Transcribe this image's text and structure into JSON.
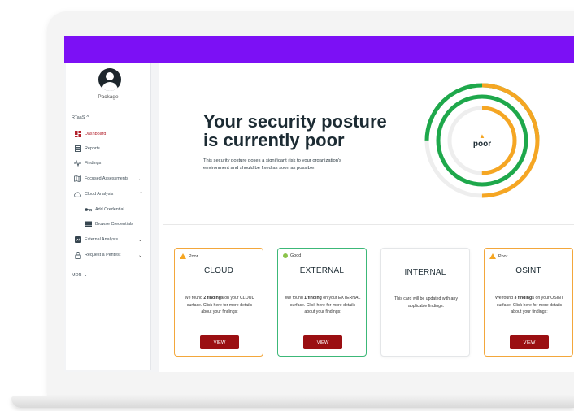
{
  "sidebar": {
    "package_label": "Package",
    "section_rtaas": "RTaaS",
    "section_mdr": "MDR",
    "items": [
      {
        "label": "Dashboard"
      },
      {
        "label": "Reports"
      },
      {
        "label": "Findings"
      },
      {
        "label": "Focused Assessments"
      },
      {
        "label": "Cloud Analysis"
      },
      {
        "label": "Add Credential"
      },
      {
        "label": "Browse Credentials"
      },
      {
        "label": "External Analysis"
      },
      {
        "label": "Request a Pentest"
      }
    ]
  },
  "hero": {
    "title": "Your security posture is currently poor",
    "description": "This security posture poses a significant risk to your organization's environment and should be fixed as soon as possible.",
    "gauge_label": "poor"
  },
  "cards": [
    {
      "status": "Poor",
      "title": "CLOUD",
      "pre": "We found ",
      "bold": "2 findings",
      "post": " on your CLOUD surface. Click here for more details about your findings:",
      "button": "VIEW"
    },
    {
      "status": "Good",
      "title": "EXTERNAL",
      "pre": "We found ",
      "bold": "1 finding",
      "post": " on your EXTERNAL surface. Click here for more details about your findings:",
      "button": "VIEW"
    },
    {
      "title": "INTERNAL",
      "body": "This card will be updated with any applicable findings."
    },
    {
      "status": "Poor",
      "title": "OSINT",
      "pre": "We found ",
      "bold": "3 findings",
      "post": " on your OSINT surface. Click here for more details about your findings:",
      "button": "VIEW"
    }
  ],
  "colors": {
    "topbar": "#7c10f5",
    "poor": "#f5a623",
    "good": "#1ea84b",
    "button": "#9b0f12",
    "active": "#b2202b"
  }
}
